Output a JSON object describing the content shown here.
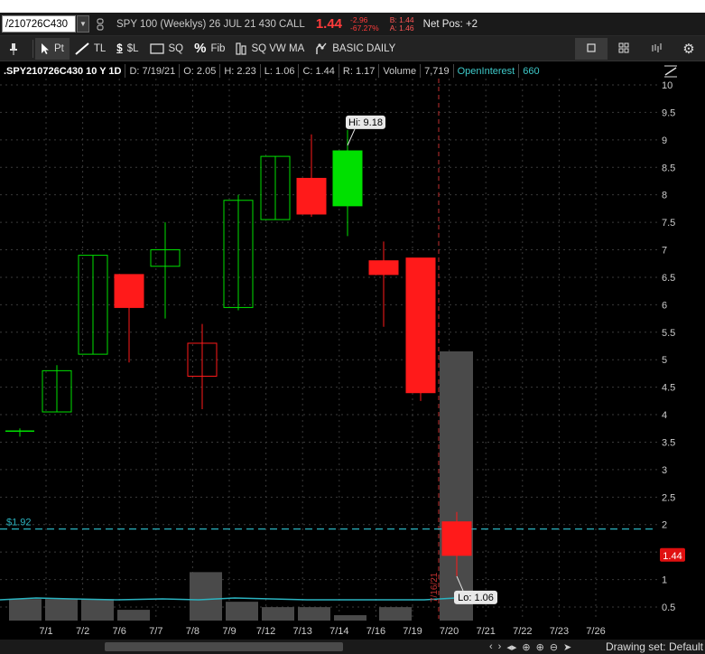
{
  "quote": {
    "symbol": "/210726C430",
    "description": "SPY 100 (Weeklys) 26 JUL 21 430 CALL",
    "last": "1.44",
    "change": "-2.96",
    "change_pct": "-67.27%",
    "bid": "B: 1.44",
    "ask": "A: 1.46",
    "net_pos": "Net Pos: +2"
  },
  "toolbar": {
    "pin": "",
    "pointer": "Pt",
    "trendline": "TL",
    "price_level": "$L",
    "square": "SQ",
    "fib": "Fib",
    "vwma": "SQ VW MA",
    "studies": "BASIC DAILY"
  },
  "info": {
    "symbol_period": ".SPY210726C430 10 Y 1D",
    "date": "D: 7/19/21",
    "open": "O: 2.05",
    "high": "H: 2.23",
    "low": "L: 1.06",
    "close": "C: 1.44",
    "range": "R: 1.17",
    "volume_label": "Volume",
    "volume": "7,719",
    "oi_label": "OpenInterest",
    "oi": "660"
  },
  "bottom": {
    "drawing_set": "Drawing set: Default"
  },
  "colors": {
    "up": "#00e000",
    "down": "#ff1a1a",
    "grid": "#3a3a3a",
    "cursor_line": "#c03030",
    "price_line": "#2bb3c0",
    "oi_line": "#2bb3c0",
    "volume": "#4a4a4a"
  },
  "chart_data": {
    "type": "candlestick",
    "ylim": [
      0.3,
      10.1
    ],
    "y_ticks": [
      "0.5",
      "1",
      "1.5",
      "2",
      "2.5",
      "3",
      "3.5",
      "4",
      "4.5",
      "5",
      "5.5",
      "6",
      "6.5",
      "7",
      "7.5",
      "8",
      "8.5",
      "9",
      "9.5",
      "10"
    ],
    "x_labels": [
      "7/1",
      "7/2",
      "7/6",
      "7/7",
      "7/8",
      "7/9",
      "7/12",
      "7/13",
      "7/14",
      "7/16",
      "7/19",
      "7/20",
      "7/21",
      "7/22",
      "7/23",
      "7/26"
    ],
    "candles": [
      {
        "o": 3.7,
        "h": 3.75,
        "l": 3.6,
        "c": 3.7
      },
      {
        "o": 4.05,
        "h": 4.9,
        "l": 4.05,
        "c": 4.8
      },
      {
        "o": 5.1,
        "h": 6.9,
        "l": 5.1,
        "c": 6.9
      },
      {
        "o": 6.55,
        "h": 6.55,
        "l": 4.95,
        "c": 5.95
      },
      {
        "o": 6.7,
        "h": 7.5,
        "l": 5.75,
        "c": 7.0
      },
      {
        "o": 5.3,
        "h": 5.65,
        "l": 4.1,
        "c": 4.7
      },
      {
        "o": 5.95,
        "h": 8.0,
        "l": 5.9,
        "c": 7.9
      },
      {
        "o": 7.55,
        "h": 8.7,
        "l": 7.55,
        "c": 8.7
      },
      {
        "o": 8.3,
        "h": 9.1,
        "l": 7.6,
        "c": 7.65
      },
      {
        "o": 7.8,
        "h": 9.18,
        "l": 7.25,
        "c": 8.8
      },
      {
        "o": 6.8,
        "h": 7.15,
        "l": 5.6,
        "c": 6.55
      },
      {
        "o": 6.85,
        "h": 6.85,
        "l": 4.25,
        "c": 4.4
      },
      {
        "o": 2.05,
        "h": 2.23,
        "l": 1.06,
        "c": 1.44
      }
    ],
    "volume": [
      {
        "label": "7/1",
        "value": 0.08
      },
      {
        "label": "7/2",
        "value": 0.08
      },
      {
        "label": "7/6",
        "value": 0.08
      },
      {
        "label": "7/7",
        "value": 0.04
      },
      {
        "label": "7/8",
        "value": 0.18
      },
      {
        "label": "7/9",
        "value": 0.07
      },
      {
        "label": "7/12",
        "value": 0.05
      },
      {
        "label": "7/13",
        "value": 0.05
      },
      {
        "label": "7/14",
        "value": 0.02
      },
      {
        "label": "7/16",
        "value": 0.05
      },
      {
        "label": "7/19",
        "value": 1.0
      }
    ],
    "hi_label": "Hi: 9.18",
    "lo_label": "Lo: 1.06",
    "price_line_label": "$1.92",
    "price_line_value": 1.92,
    "last_label": "1.44",
    "last_value": 1.44,
    "cursor_date": "7/16/21"
  }
}
